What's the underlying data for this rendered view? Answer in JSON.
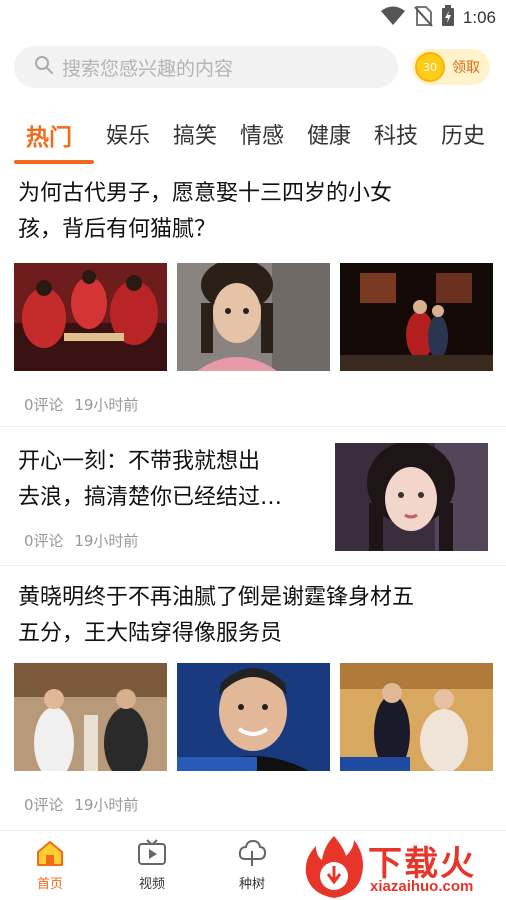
{
  "status_bar": {
    "time": "1:06",
    "icons": [
      "wifi-icon",
      "no-sim-icon",
      "battery-charging-icon"
    ]
  },
  "search": {
    "placeholder": "搜索您感兴趣的内容",
    "coin_value": "30",
    "claim_label": "领取"
  },
  "tabs": [
    "热门",
    "娱乐",
    "搞笑",
    "情感",
    "健康",
    "科技",
    "历史"
  ],
  "active_tab": "热门",
  "accent_color": "#f26a1b",
  "articles": [
    {
      "title_line1": "为何古代男子，愿意娶十三四岁的小女",
      "title_line2": "孩，背后有何猫腻？",
      "comments": "0评论",
      "time": "19小时前"
    },
    {
      "title_line1": "开心一刻：不带我就想出",
      "title_line2": "去浪，搞清楚你已经结过…",
      "comments": "0评论",
      "time": "19小时前"
    },
    {
      "title_line1": "黄晓明终于不再油腻了倒是谢霆锋身材五",
      "title_line2": "五分，王大陆穿得像服务员",
      "comments": "0评论",
      "time": "19小时前"
    }
  ],
  "bottom_nav": [
    {
      "label": "首页",
      "icon": "home-icon"
    },
    {
      "label": "视频",
      "icon": "video-icon"
    },
    {
      "label": "种树",
      "icon": "tree-icon"
    }
  ],
  "watermark": {
    "title": "下载火",
    "url": "xiazaihuo.com"
  }
}
